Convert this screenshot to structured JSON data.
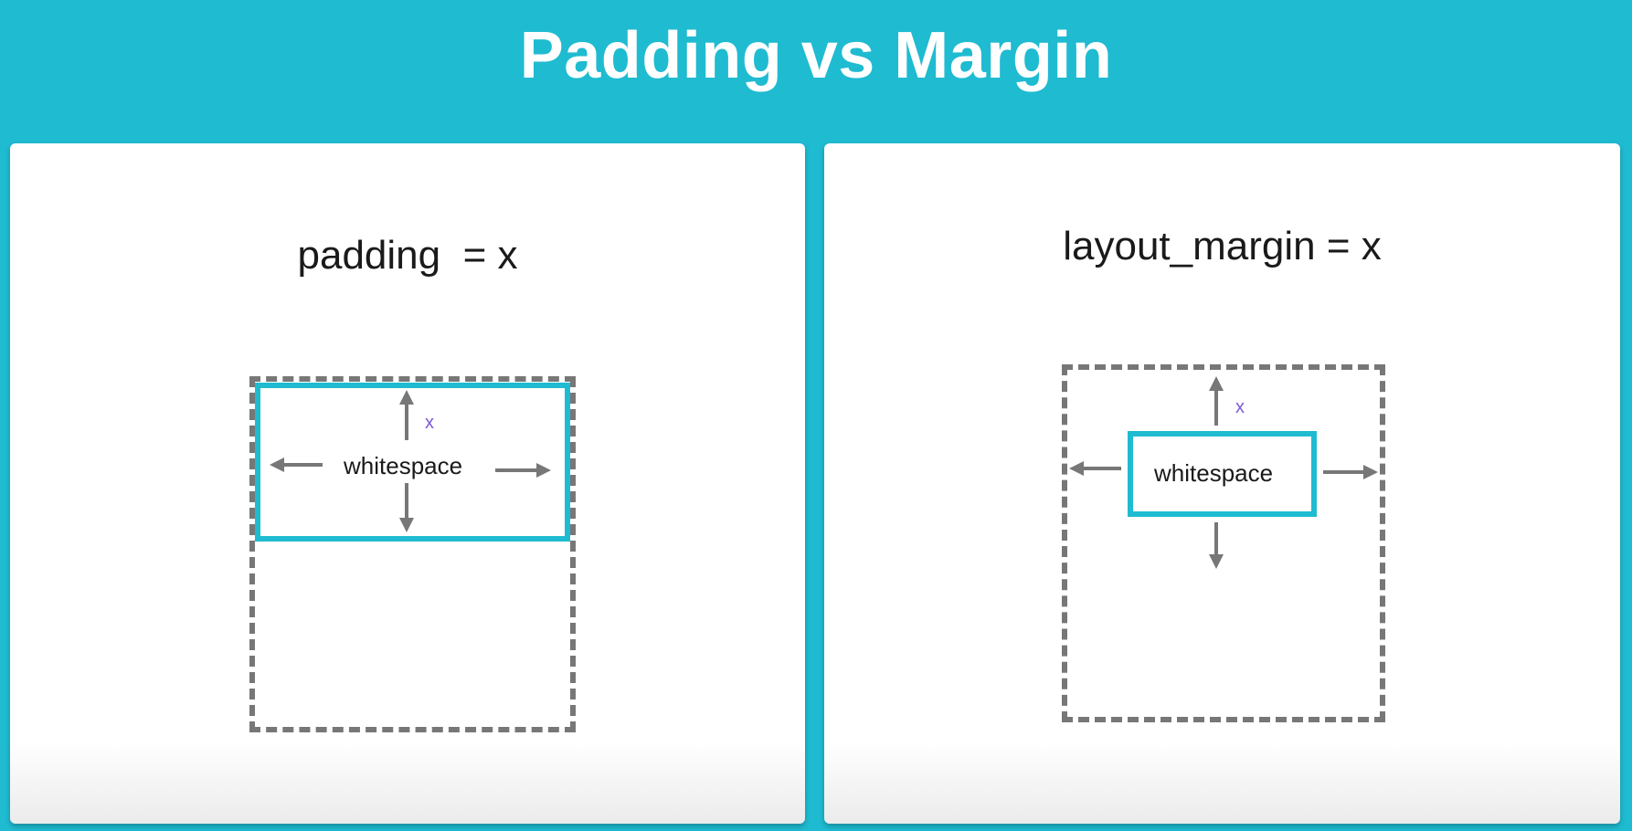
{
  "title": "Padding vs Margin",
  "colors": {
    "background": "#1fbbd1",
    "box_border": "#1fbbd1",
    "dashed_border": "#777777",
    "x_label": "#7b5bd6"
  },
  "left_panel": {
    "heading": "padding  = x",
    "inner_label": "whitespace",
    "x_label": "x"
  },
  "right_panel": {
    "heading": "layout_margin = x",
    "inner_label": "whitespace",
    "x_label": "x"
  }
}
